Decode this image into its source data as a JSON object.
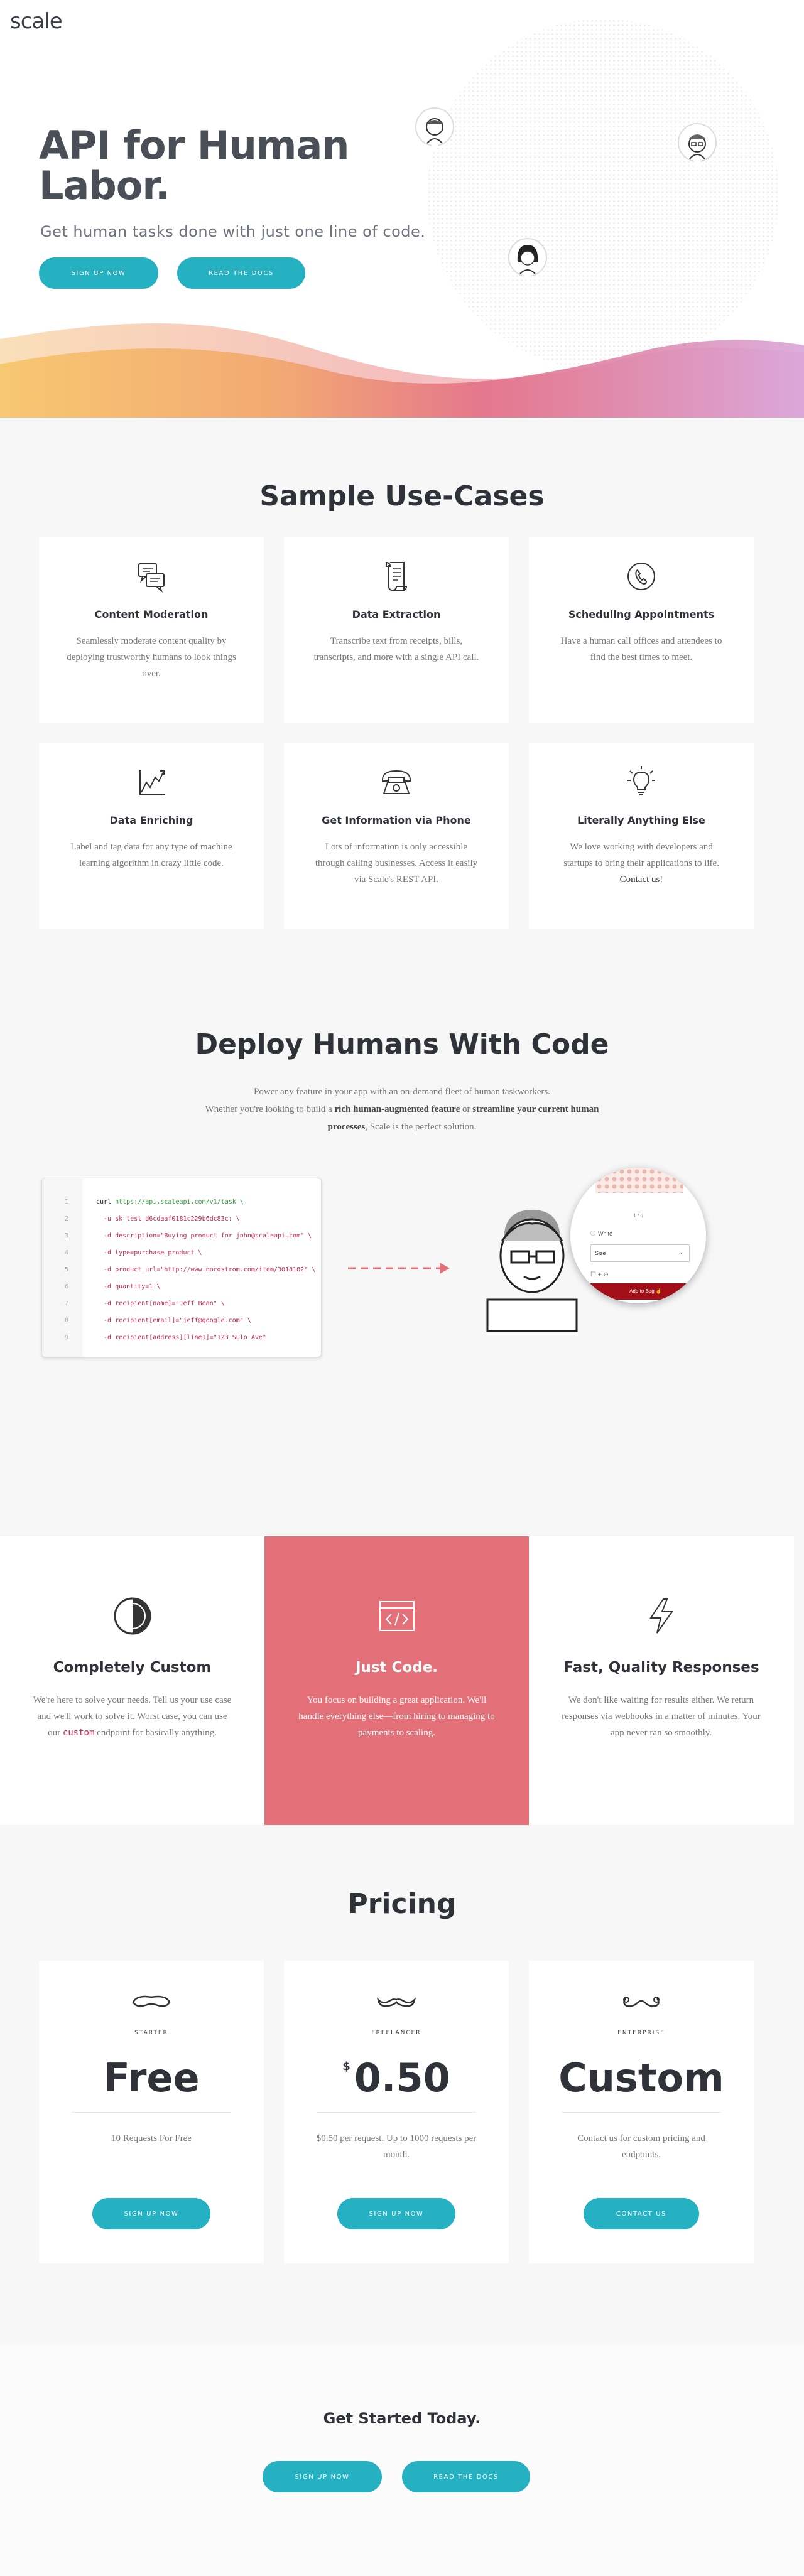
{
  "header": {
    "logo": "scale"
  },
  "hero": {
    "title": "API for Human Labor.",
    "subtitle": "Get human tasks done with just one line of code.",
    "signup_label": "SIGN UP NOW",
    "docs_label": "READ THE DOCS"
  },
  "use_cases": {
    "title": "Sample Use-Cases",
    "items": [
      {
        "icon": "chat-bubbles-icon",
        "title": "Content Moderation",
        "text": "Seamlessly moderate content quality by deploying trustworthy humans to look things over."
      },
      {
        "icon": "receipt-scroll-icon",
        "title": "Data Extraction",
        "text": "Transcribe text from receipts, bills, transcripts, and more with a single API call."
      },
      {
        "icon": "phone-circle-icon",
        "title": "Scheduling Appointments",
        "text": "Have a human call offices and attendees to find the best times to meet."
      },
      {
        "icon": "line-chart-icon",
        "title": "Data Enriching",
        "text": "Label and tag data for any type of machine learning algorithm in crazy little code."
      },
      {
        "icon": "telephone-icon",
        "title": "Get Information via Phone",
        "text": "Lots of information is only accessible through calling businesses. Access it easily via Scale's REST API."
      },
      {
        "icon": "lightbulb-icon",
        "title": "Literally Anything Else",
        "text": "We love working with developers and startups to bring their applications to life.",
        "link": "Contact us",
        "suffix": "!"
      }
    ]
  },
  "deploy": {
    "title": "Deploy Humans With Code",
    "p1": "Power any feature in your app with an on-demand fleet of human taskworkers.",
    "p2a": "Whether you're looking to build a ",
    "p2b": "rich human-augmented feature",
    "p2c": " or ",
    "p2d": "streamline your current human processes",
    "p2e": ", Scale is the perfect solution.",
    "code_lines": [
      {
        "n": "1",
        "t": "curl ",
        "url": "https://api.scaleapi.com/v1/task \\"
      },
      {
        "n": "2",
        "t": "  -u sk_test_d6cdaaf0181c229b6dc83c: \\"
      },
      {
        "n": "3",
        "t": "  -d description=\"Buying product for john@scaleapi.com\" \\"
      },
      {
        "n": "4",
        "t": "  -d type=purchase_product \\"
      },
      {
        "n": "5",
        "t": "  -d product_url=\"http://www.nordstrom.com/item/3018182\" \\"
      },
      {
        "n": "6",
        "t": "  -d quantity=1 \\"
      },
      {
        "n": "7",
        "t": "  -d recipient[name]=\"Jeff Bean\" \\"
      },
      {
        "n": "8",
        "t": "  -d recipient[email]=\"jeff@google.com\" \\"
      },
      {
        "n": "9",
        "t": "  -d recipient[address][line1]=\"123 Sulo Ave\""
      }
    ],
    "phone": {
      "pager": "1 / 6",
      "color": "White",
      "size": "Size",
      "add_to_bag": "Add to Bag"
    }
  },
  "features": [
    {
      "icon": "half-circle-icon",
      "title": "Completely Custom",
      "text_a": "We're here to solve your needs. Tell us your use case and we'll work to solve it. Worst case, you can use our ",
      "code": "custom",
      "text_b": " endpoint for basically anything."
    },
    {
      "icon": "code-window-icon",
      "title": "Just Code.",
      "text_a": "You focus on building a great application. We'll handle everything else—from hiring to managing to payments to scaling."
    },
    {
      "icon": "lightning-bolt-icon",
      "title": "Fast, Quality Responses",
      "text_a": "We don't like waiting for results either. We return responses via webhooks in a matter of minutes. Your app never ran so smoothly."
    }
  ],
  "pricing": {
    "title": "Pricing",
    "plans": [
      {
        "icon": "mustache-starter-icon",
        "tier": "STARTER",
        "price": "Free",
        "currency": "",
        "desc": "10 Requests For Free",
        "button": "SIGN UP NOW"
      },
      {
        "icon": "mustache-freelancer-icon",
        "tier": "FREELANCER",
        "price": "0.50",
        "currency": "$",
        "desc": "$0.50 per request. Up to 1000 requests per month.",
        "button": "SIGN UP NOW"
      },
      {
        "icon": "mustache-enterprise-icon",
        "tier": "ENTERPRISE",
        "price": "Custom",
        "currency": "",
        "desc": "Contact us for custom pricing and endpoints.",
        "button": "CONTACT US"
      }
    ]
  },
  "cta": {
    "title": "Get Started Today.",
    "signup_label": "SIGN UP NOW",
    "docs_label": "READ THE DOCS"
  },
  "colors": {
    "accent": "#26b1c3",
    "feature_red": "#e37078",
    "wave_orange": "#f2a56b",
    "wave_pink": "#e36f86",
    "wave_purple": "#d9a4d8"
  }
}
